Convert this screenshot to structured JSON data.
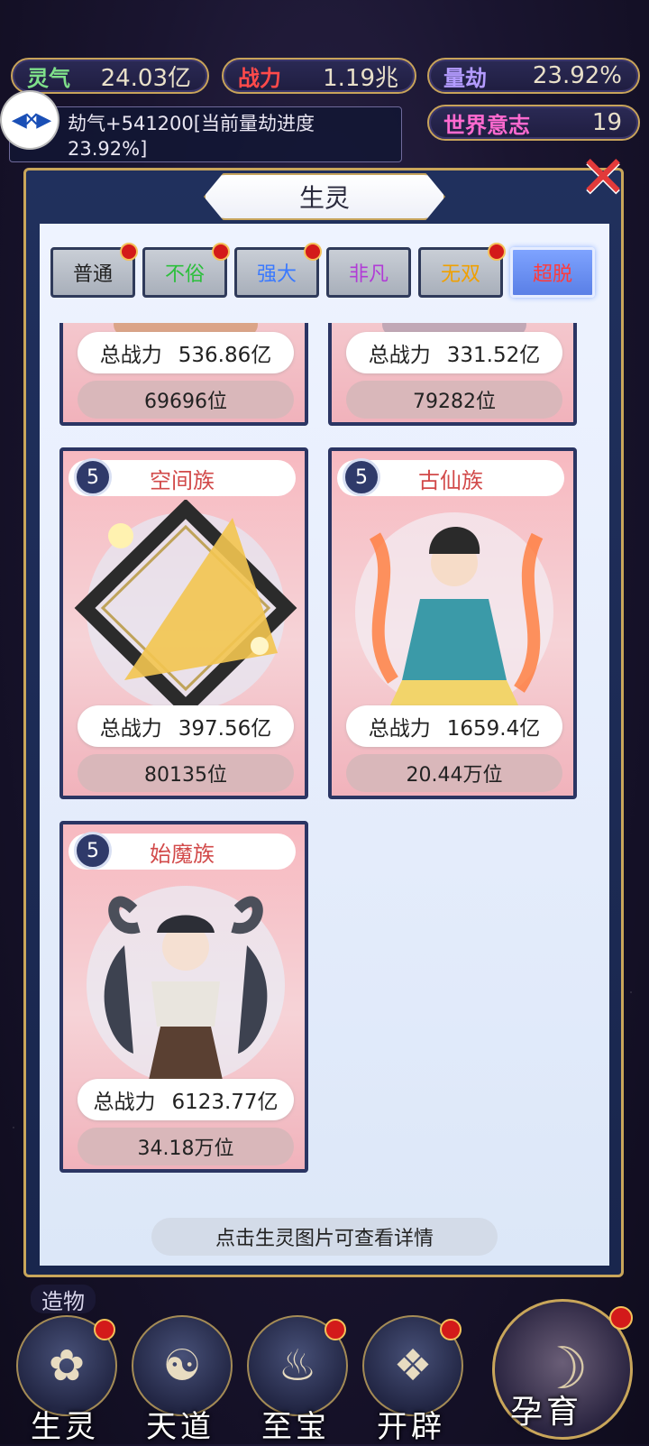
{
  "top_stats": {
    "lingqi": {
      "label": "灵气",
      "value": "24.03亿",
      "label_color": "#7fe08a"
    },
    "zhanli": {
      "label": "战力",
      "value": "1.19兆",
      "label_color": "#ff4a4a"
    },
    "liangjie": {
      "label": "量劫",
      "value": "23.92%",
      "label_color": "#b49cff"
    },
    "world_will": {
      "label": "世界意志",
      "value": "19",
      "label_color": "#ff6ad0"
    }
  },
  "notice": {
    "text": "劫气+541200[当前量劫进度23.92%]"
  },
  "panel": {
    "title": "生灵",
    "hint": "点击生灵图片可查看详情"
  },
  "tabs": [
    {
      "label": "普通",
      "color": "#222222",
      "badge": true
    },
    {
      "label": "不俗",
      "color": "#2bbf3b",
      "badge": true
    },
    {
      "label": "强大",
      "color": "#3a79ff",
      "badge": true
    },
    {
      "label": "非凡",
      "color": "#b13bd6",
      "badge": false
    },
    {
      "label": "无双",
      "color": "#f0a000",
      "badge": true
    },
    {
      "label": "超脱",
      "color": "#ff3b3b",
      "badge": false,
      "active": true
    }
  ],
  "cards": [
    {
      "name": "",
      "level": "",
      "power_label": "总战力",
      "power": "536.86亿",
      "rank": "69696位"
    },
    {
      "name": "",
      "level": "",
      "power_label": "总战力",
      "power": "331.52亿",
      "rank": "79282位"
    },
    {
      "name": "空间族",
      "level": "5",
      "power_label": "总战力",
      "power": "397.56亿",
      "rank": "80135位"
    },
    {
      "name": "古仙族",
      "level": "5",
      "power_label": "总战力",
      "power": "1659.4亿",
      "rank": "20.44万位"
    },
    {
      "name": "始魔族",
      "level": "5",
      "power_label": "总战力",
      "power": "6123.77亿",
      "rank": "34.18万位"
    }
  ],
  "side_label": {
    "text": "造物"
  },
  "bottom_nav": [
    {
      "label": "生灵",
      "icon": "lotus-icon",
      "badge": true
    },
    {
      "label": "天道",
      "icon": "swirl-icon",
      "badge": false
    },
    {
      "label": "至宝",
      "icon": "flame-icon",
      "badge": true
    },
    {
      "label": "开辟",
      "icon": "crystal-icon",
      "badge": true
    },
    {
      "label": "孕育",
      "icon": "embryo-icon",
      "badge": true
    }
  ]
}
